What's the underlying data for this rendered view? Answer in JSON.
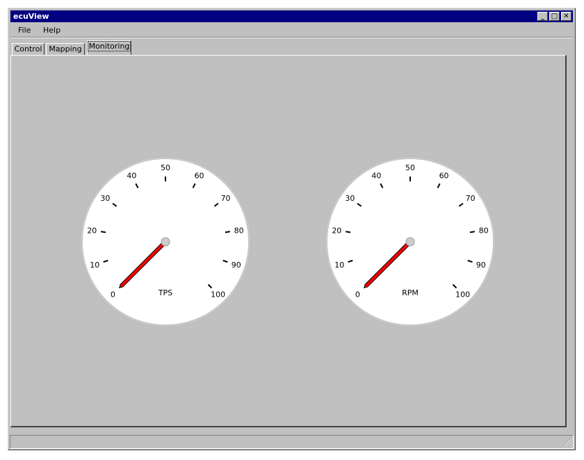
{
  "window": {
    "title": "ecuView"
  },
  "title_buttons": {
    "minimize": "_",
    "maximize": "□",
    "close": "✕"
  },
  "menu": {
    "items": [
      "File",
      "Help"
    ]
  },
  "tabs": {
    "items": [
      "Control",
      "Mapping",
      "Monitoring"
    ],
    "active": "Monitoring"
  },
  "gauges": [
    {
      "label": "TPS",
      "value": 0,
      "min": 0,
      "max": 100,
      "ticks": [
        "0",
        "10",
        "20",
        "30",
        "40",
        "50",
        "60",
        "70",
        "80",
        "90",
        "100"
      ]
    },
    {
      "label": "RPM",
      "value": 0,
      "min": 0,
      "max": 100,
      "ticks": [
        "0",
        "10",
        "20",
        "30",
        "40",
        "50",
        "60",
        "70",
        "80",
        "90",
        "100"
      ]
    }
  ],
  "colors": {
    "titlebar": "#000080",
    "needle": "#ff0000",
    "face": "#ffffff",
    "bezel": "#c8c8c8"
  },
  "statusbar": {
    "text": ""
  }
}
